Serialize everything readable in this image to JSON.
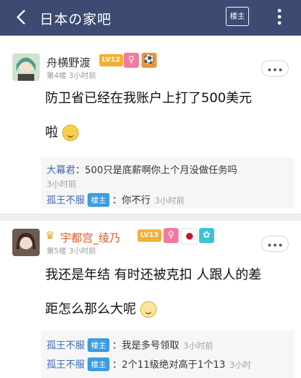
{
  "header": {
    "title": "日本の家吧",
    "owner_only": "楼主"
  },
  "post1": {
    "username": "舟横野渡",
    "level": "LV12",
    "floor": "第4楼",
    "time": "3小时前",
    "content_line1": "防卫省已经在我账户上打了500美元",
    "content_line2": "啦",
    "replies": [
      {
        "name": "大幕君",
        "text": "：500只是底薪啊你上个月没做任务吗",
        "time": "3小时前"
      },
      {
        "name": "孤王不服",
        "tag": "楼主",
        "text": "：你不行",
        "time": "3小时前"
      }
    ]
  },
  "post2": {
    "username": "宇都宫_绫乃",
    "level": "LV13",
    "floor": "第5楼",
    "time": "3小时前",
    "content_line1": "我还是年结 有时还被克扣 人跟人的差",
    "content_line2": "距怎么那么大呢",
    "replies": [
      {
        "name": "孤王不服",
        "tag": "楼主",
        "text": "：我是多号领取",
        "time": "3小时前"
      },
      {
        "name": "孤王不服",
        "tag": "楼主",
        "text": "：2个11级绝对高于1个13",
        "time": "3小时"
      }
    ]
  },
  "colors": {
    "header_bg": "#3d4b73",
    "level_badge": "#f3b035",
    "owner_tag": "#3a9de0",
    "username_red": "#e05a23"
  }
}
